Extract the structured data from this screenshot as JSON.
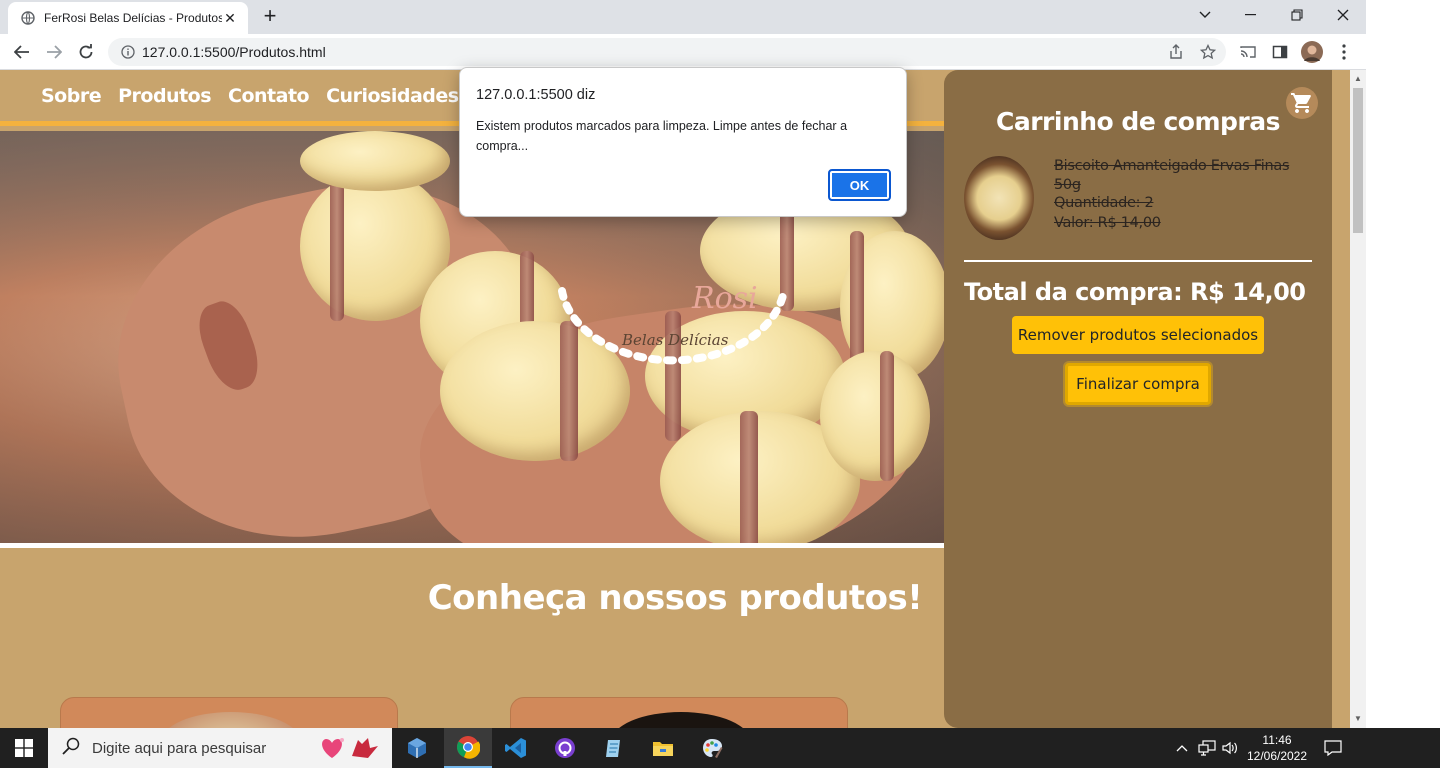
{
  "browser": {
    "tab_title": "FerRosi Belas Delícias - Produtos",
    "url": "127.0.0.1:5500/Produtos.html"
  },
  "nav": {
    "items": [
      "Sobre",
      "Produtos",
      "Contato",
      "Curiosidades"
    ]
  },
  "hero": {
    "logo_line1": "Rosi",
    "logo_line2": "Belas Delícias"
  },
  "products_section": {
    "title": "Conheça nossos produtos!"
  },
  "cart": {
    "title": "Carrinho de compras",
    "item": {
      "name": "Biscoito Amanteigado Ervas Finas 50g",
      "quantity": "Quantidade: 2",
      "value": "Valor: R$ 14,00"
    },
    "total": "Total da compra: R$ 14,00",
    "remove_label": "Remover produtos selecionados",
    "finish_label": "Finalizar compra"
  },
  "dialog": {
    "title": "127.0.0.1:5500 diz",
    "message": "Existem produtos marcados para limpeza. Limpe antes de fechar a compra...",
    "ok_label": "OK"
  },
  "taskbar": {
    "search_placeholder": "Digite aqui para pesquisar",
    "time": "11:46",
    "date": "12/06/2022"
  },
  "colors": {
    "page_bg": "#c8a46d",
    "nav_underline": "#f4b23e",
    "cart_bg": "#8a6d45",
    "button_yellow": "#ffc107",
    "dialog_button": "#1a73e8"
  }
}
